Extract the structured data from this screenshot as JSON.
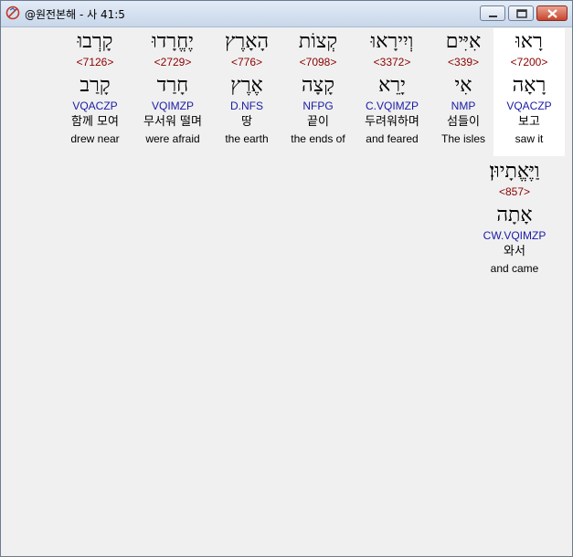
{
  "window": {
    "title": "@원전본해 - 사 41:5"
  },
  "words": [
    {
      "hebrew": "רָאוּ",
      "strong": "<7200>",
      "lemma": "רָאָה",
      "parse": "VQACZP",
      "korean": "보고",
      "english": "saw it"
    },
    {
      "hebrew": "אִיִּים",
      "strong": "<339>",
      "lemma": "אִי",
      "parse": "NMP",
      "korean": "섬들이",
      "english": "The isles"
    },
    {
      "hebrew": "וְיִירָאוּ",
      "strong": "<3372>",
      "lemma": "יָרֵא",
      "parse": "C.VQIMZP",
      "korean": "두려워하며",
      "english": "and feared"
    },
    {
      "hebrew": "קְצוֹת",
      "strong": "<7098>",
      "lemma": "קָצָה",
      "parse": "NFPG",
      "korean": "끝이",
      "english": "the ends of"
    },
    {
      "hebrew": "הָאָרֶץ",
      "strong": "<776>",
      "lemma": "אֶרֶץ",
      "parse": "D.NFS",
      "korean": "땅",
      "english": "the earth"
    },
    {
      "hebrew": "יֶחֱרָדוּ",
      "strong": "<2729>",
      "lemma": "חָרַד",
      "parse": "VQIMZP",
      "korean": "무서워 떨며",
      "english": "were afraid"
    },
    {
      "hebrew": "קָרְבוּ",
      "strong": "<7126>",
      "lemma": "קָרַב",
      "parse": "VQACZP",
      "korean": "함께 모여",
      "english": "drew near"
    },
    {
      "hebrew": "וַיֶּאֱתָיוּן׃",
      "strong": "<857>",
      "lemma": "אָתָה",
      "parse": "CW.VQIMZP",
      "korean": "와서",
      "english": "and came"
    }
  ]
}
